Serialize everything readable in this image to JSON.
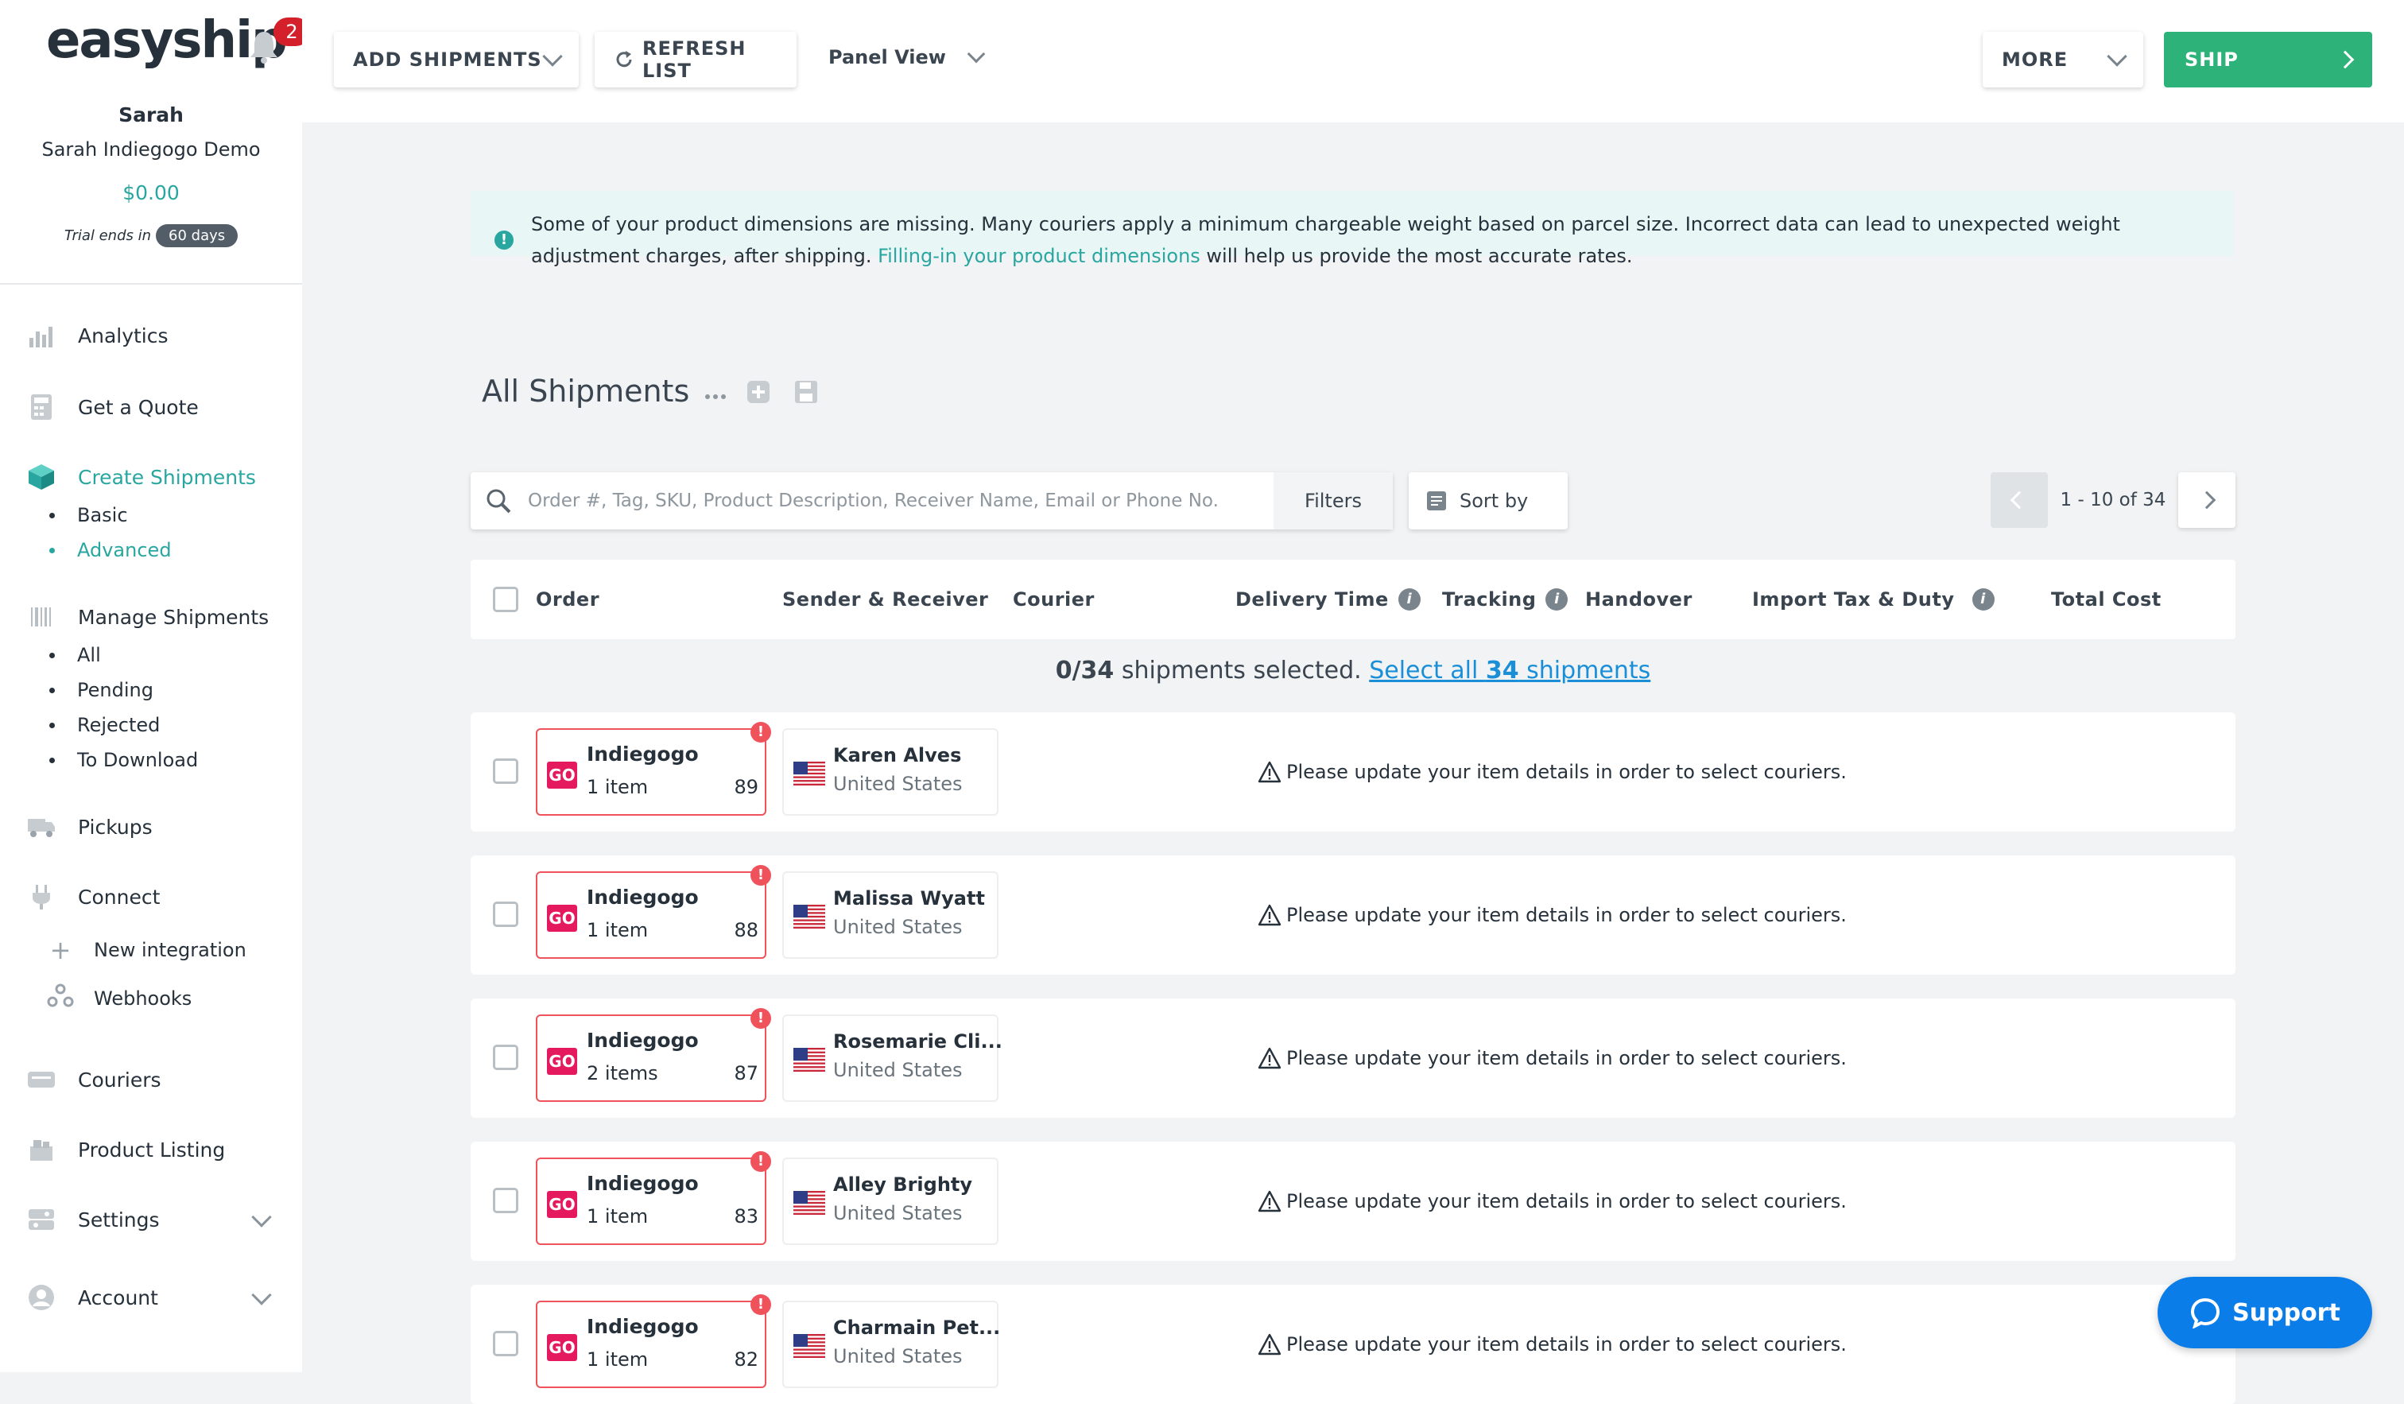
{
  "brand": {
    "logo": "easyship",
    "notification_count": "2"
  },
  "user": {
    "name": "Sarah",
    "org": "Sarah Indiegogo Demo",
    "balance": "$0.00",
    "trial_label": "Trial ends in",
    "trial_days": "60 days"
  },
  "sidebar": {
    "analytics": "Analytics",
    "get_quote": "Get a Quote",
    "create_shipments": "Create Shipments",
    "create_sub": [
      "Basic",
      "Advanced"
    ],
    "manage_shipments": "Manage Shipments",
    "manage_sub": [
      "All",
      "Pending",
      "Rejected",
      "To Download"
    ],
    "pickups": "Pickups",
    "connect": "Connect",
    "connect_sub": [
      "New integration",
      "Webhooks"
    ],
    "couriers": "Couriers",
    "product_listing": "Product Listing",
    "settings": "Settings",
    "account": "Account"
  },
  "toolbar": {
    "add_shipments": "ADD SHIPMENTS",
    "refresh_list": "REFRESH LIST",
    "panel_view": "Panel View",
    "more": "MORE",
    "ship": "SHIP"
  },
  "alert": {
    "text_before": "Some of your product dimensions are missing. Many couriers apply a minimum chargeable weight based on parcel size. Incorrect data can lead to unexpected weight adjustment charges, after shipping. ",
    "link": "Filling-in your product dimensions",
    "text_after": " will help us provide the most accurate rates."
  },
  "list": {
    "title": "All Shipments",
    "search_placeholder": "Order #, Tag, SKU, Product Description, Receiver Name, Email or Phone No.",
    "filters": "Filters",
    "sort_by": "Sort by",
    "pagination": "1 - 10 of 34"
  },
  "table": {
    "columns": {
      "order": "Order",
      "sender_receiver": "Sender & Receiver",
      "courier": "Courier",
      "delivery_time": "Delivery Time",
      "tracking": "Tracking",
      "handover": "Handover",
      "import_tax": "Import Tax & Duty",
      "total_cost": "Total Cost"
    },
    "selection": {
      "count": "0/34",
      "text": " shipments selected. ",
      "link_prefix": "Select all ",
      "link_count": "34",
      "link_suffix": " shipments"
    },
    "rows": [
      {
        "store": "Indiegogo",
        "items": "1 item",
        "order_no": "89",
        "receiver": "Karen Alves",
        "country": "United States",
        "message": "Please update your item details in order to select couriers."
      },
      {
        "store": "Indiegogo",
        "items": "1 item",
        "order_no": "88",
        "receiver": "Malissa Wyatt",
        "country": "United States",
        "message": "Please update your item details in order to select couriers."
      },
      {
        "store": "Indiegogo",
        "items": "2 items",
        "order_no": "87",
        "receiver": "Rosemarie Cli...",
        "country": "United States",
        "message": "Please update your item details in order to select couriers."
      },
      {
        "store": "Indiegogo",
        "items": "1 item",
        "order_no": "83",
        "receiver": "Alley Brighty",
        "country": "United States",
        "message": "Please update your item details in order to select couriers."
      },
      {
        "store": "Indiegogo",
        "items": "1 item",
        "order_no": "82",
        "receiver": "Charmain Pet...",
        "country": "United States",
        "message": "Please update your item details in order to select couriers."
      }
    ]
  },
  "support": {
    "label": "Support"
  },
  "colors": {
    "accent": "#2aa6a0",
    "ship_green": "#2db27a",
    "danger": "#f0525c",
    "support_blue": "#0b7de8",
    "go_pink": "#e5195e"
  }
}
